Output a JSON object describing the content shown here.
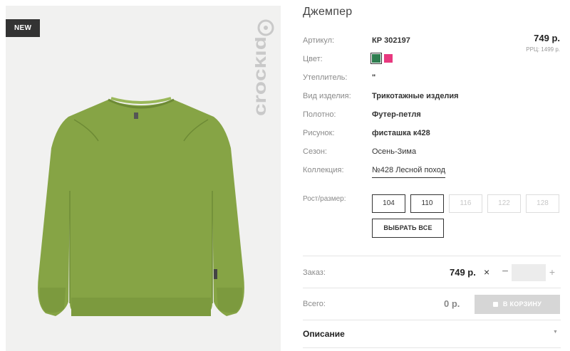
{
  "product": {
    "badge": "NEW",
    "brand": "crockid",
    "title": "Джемпер"
  },
  "attributes": [
    {
      "label": "Артикул:",
      "value": "КР 302197"
    },
    {
      "label": "Цвет:",
      "value": ""
    },
    {
      "label": "Утеплитель:",
      "value": "\""
    },
    {
      "label": "Вид изделия:",
      "value": "Трикотажные изделия"
    },
    {
      "label": "Полотно:",
      "value": "Футер-петля"
    },
    {
      "label": "Рисунок:",
      "value": "фисташка к428"
    },
    {
      "label": "Сезон:",
      "value": "Осень-Зима"
    },
    {
      "label": "Коллекция:",
      "value": "№428 Лесной поход"
    }
  ],
  "colors": {
    "swatches": [
      "#2e7d4f",
      "#e8397f"
    ],
    "selected": "#2e7d4f",
    "sweater": "#86a445"
  },
  "pricing": {
    "price": "749 р.",
    "rrp": "РРЦ: 1499 р."
  },
  "sizes": {
    "label": "Рост/размер:",
    "options": [
      {
        "label": "104",
        "available": true
      },
      {
        "label": "110",
        "available": true
      },
      {
        "label": "116",
        "available": false
      },
      {
        "label": "122",
        "available": false
      },
      {
        "label": "128",
        "available": false
      }
    ],
    "select_all": "ВЫБРАТЬ ВСЕ"
  },
  "order": {
    "label": "Заказ:",
    "price": "749 р.",
    "times": "×",
    "minus": "−",
    "plus": "+",
    "quantity": ""
  },
  "total": {
    "label": "Всего:",
    "value": "0 р.",
    "cart_button": "В КОРЗИНУ"
  },
  "description": {
    "title": "Описание",
    "arrow": "▼"
  }
}
